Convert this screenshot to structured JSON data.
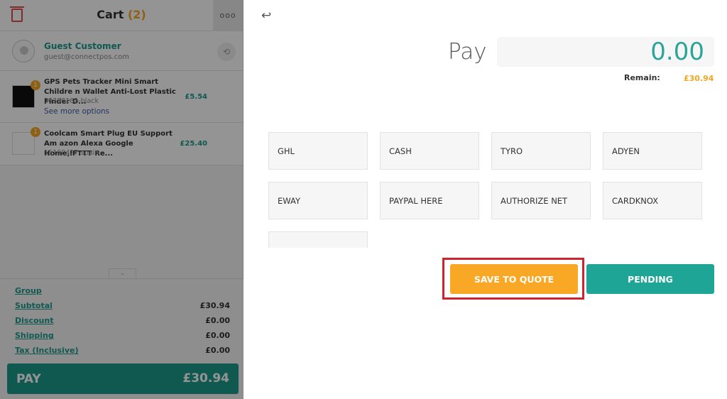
{
  "cart": {
    "title": "Cart",
    "count": "(2)",
    "more_icon": "ooo",
    "customer": {
      "name": "Guest Customer",
      "email": "guest@connectpos.com"
    },
    "items": [
      {
        "qty": "1",
        "name": "GPS Pets Tracker Mini Smart Childre n Wallet Anti-Lost Plastic Finder D...",
        "sku": "30399182-black",
        "options": "See more options",
        "price": "£5.54"
      },
      {
        "qty": "1",
        "name": "Coolcam Smart Plug EU Support Am azon Alexa Google Home,IFTTT Re...",
        "sku": "15160427-spain",
        "price": "£25.40"
      }
    ],
    "totals": [
      {
        "label": "Group",
        "value": ""
      },
      {
        "label": "Subtotal",
        "value": "£30.94"
      },
      {
        "label": "Discount",
        "value": "£0.00"
      },
      {
        "label": "Shipping",
        "value": "£0.00"
      },
      {
        "label": "Tax (Inclusive)",
        "value": "£0.00"
      }
    ],
    "pay": {
      "label": "PAY",
      "amount": "£30.94"
    }
  },
  "payment": {
    "back_icon": "↩",
    "label": "Pay",
    "amount": "0.00",
    "remain_label": "Remain:",
    "remain_value": "£30.94",
    "methods": [
      "GHL",
      "CASH",
      "TYRO",
      "ADYEN",
      "EWAY",
      "PAYPAL HERE",
      "AUTHORIZE NET",
      "CARDKNOX",
      ""
    ],
    "save_to_quote": "SAVE TO QUOTE",
    "pending": "PENDING"
  },
  "colors": {
    "accent": "#1d9a8c",
    "orange": "#f9a825",
    "highlight": "#cf2430"
  }
}
